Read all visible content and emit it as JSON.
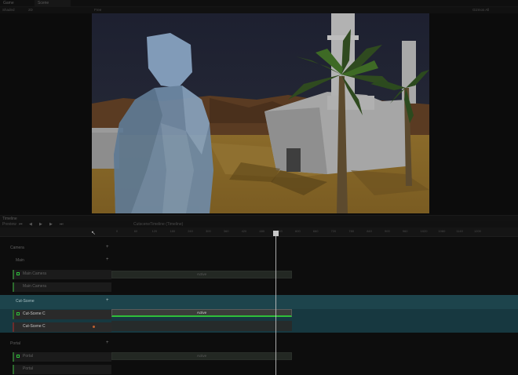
{
  "tabs": {
    "game": "Game",
    "scene": "Scene"
  },
  "toolbar": {
    "left1": "Shaded",
    "left2": "2D",
    "mid": "Free",
    "right": "Gizmos  All"
  },
  "timeline": {
    "header": "Timeline",
    "toolbar_left": "Preview",
    "toolbar_mid": "CutsceneTimeline (Timeline)",
    "ruler_ticks": [
      "0",
      "60",
      "120",
      "180",
      "240",
      "300",
      "360",
      "420",
      "480",
      "540",
      "600",
      "660",
      "720",
      "780",
      "840",
      "900",
      "960",
      "1020",
      "1080",
      "1140",
      "1200"
    ],
    "groups": {
      "camera": "Camera",
      "main": "Main",
      "cutscene": "Cut-Scene",
      "portal": "Portal"
    },
    "tracks": {
      "main_1": "Main Camera",
      "main_2": "Main Camera",
      "cut_1": "Cut-Scene C",
      "cut_2": "Cut-Scene C",
      "portal_1": "Portal",
      "portal_2": "Portal"
    },
    "clips": {
      "main_active": "Active",
      "cut_active": "Active",
      "portal_active": "Active"
    }
  },
  "colors": {
    "accent_green": "#2fbf3a",
    "selection_teal": "#1d444c",
    "playhead": "#c8c8c8"
  }
}
